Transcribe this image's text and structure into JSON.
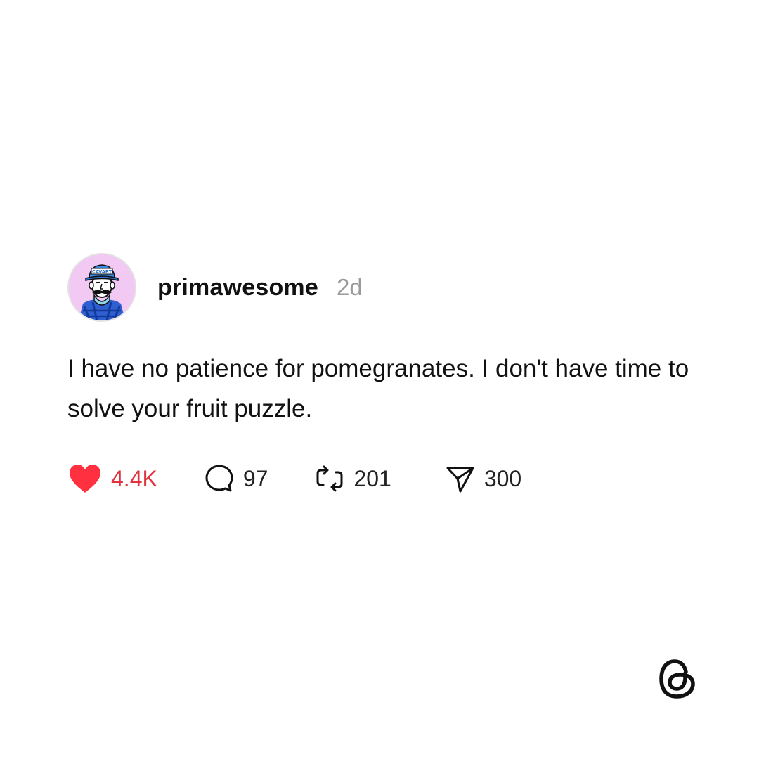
{
  "post": {
    "username": "primawesome",
    "timestamp": "2d",
    "avatar_cap_text": "CAVART",
    "text": "I have no patience for pomegranates. I don't have time to solve your fruit puzzle.",
    "actions": {
      "likes": "4.4K",
      "replies": "97",
      "reposts": "201",
      "shares": "300"
    },
    "liked": true
  },
  "colors": {
    "like_red": "#ff3040",
    "like_count": "#e0323f",
    "timestamp_gray": "#9a9a9a",
    "avatar_bg": "#f2c9f3",
    "cap_blue": "#3a86e0"
  },
  "icons": {
    "like": "heart-icon",
    "reply": "speech-bubble-icon",
    "repost": "repost-icon",
    "share": "paper-plane-icon",
    "brand": "threads-logo-icon"
  }
}
